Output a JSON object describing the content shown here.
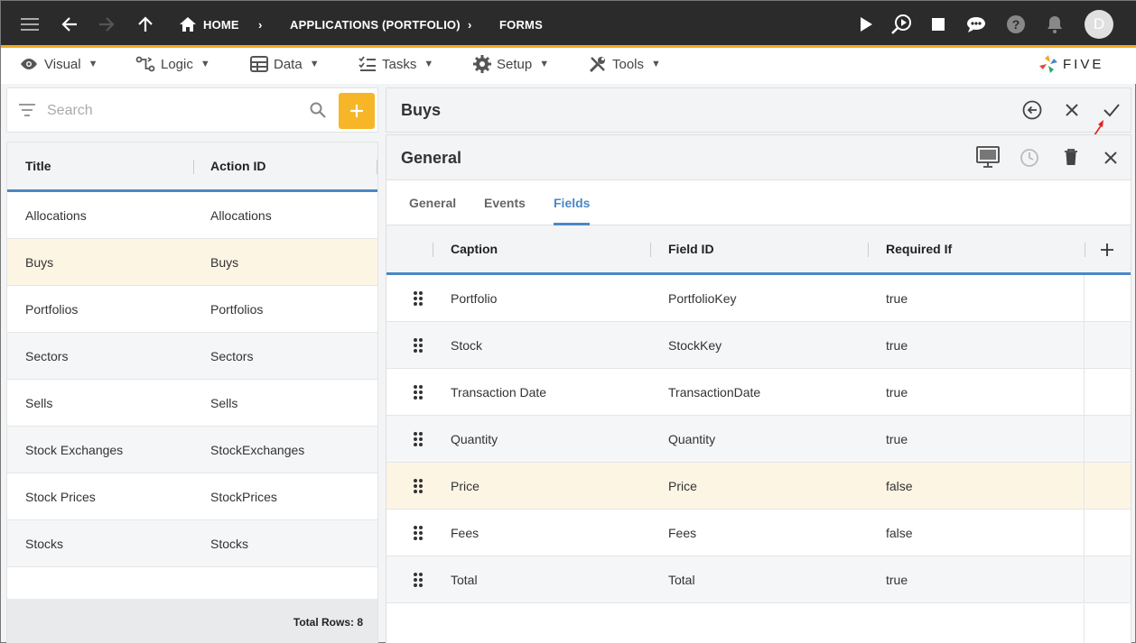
{
  "topbar": {
    "breadcrumb": [
      "HOME",
      "APPLICATIONS (PORTFOLIO)",
      "FORMS"
    ],
    "avatar_letter": "D",
    "icons": [
      "menu-icon",
      "back-arrow-icon",
      "forward-arrow-icon",
      "up-arrow-icon",
      "home-icon",
      "play-icon",
      "search-play-icon",
      "stop-icon",
      "chat-icon",
      "help-icon",
      "bell-icon"
    ]
  },
  "menubar": {
    "items": [
      "Visual",
      "Logic",
      "Data",
      "Tasks",
      "Setup",
      "Tools"
    ],
    "logo_text": "FIVE"
  },
  "search": {
    "placeholder": "Search"
  },
  "list": {
    "columns": [
      "Title",
      "Action ID"
    ],
    "rows": [
      {
        "title": "Allocations",
        "action_id": "Allocations"
      },
      {
        "title": "Buys",
        "action_id": "Buys"
      },
      {
        "title": "Portfolios",
        "action_id": "Portfolios"
      },
      {
        "title": "Sectors",
        "action_id": "Sectors"
      },
      {
        "title": "Sells",
        "action_id": "Sells"
      },
      {
        "title": "Stock Exchanges",
        "action_id": "StockExchanges"
      },
      {
        "title": "Stock Prices",
        "action_id": "StockPrices"
      },
      {
        "title": "Stocks",
        "action_id": "Stocks"
      }
    ],
    "selected_index": 1,
    "footer": "Total Rows: 8"
  },
  "form": {
    "title": "Buys",
    "sub_title": "General",
    "tabs": [
      "General",
      "Events",
      "Fields"
    ],
    "active_tab": "Fields",
    "grid_columns": [
      "Caption",
      "Field ID",
      "Required If"
    ],
    "grid_rows": [
      {
        "caption": "Portfolio",
        "field_id": "PortfolioKey",
        "required_if": "true"
      },
      {
        "caption": "Stock",
        "field_id": "StockKey",
        "required_if": "true"
      },
      {
        "caption": "Transaction Date",
        "field_id": "TransactionDate",
        "required_if": "true"
      },
      {
        "caption": "Quantity",
        "field_id": "Quantity",
        "required_if": "true"
      },
      {
        "caption": "Price",
        "field_id": "Price",
        "required_if": "false"
      },
      {
        "caption": "Fees",
        "field_id": "Fees",
        "required_if": "false"
      },
      {
        "caption": "Total",
        "field_id": "Total",
        "required_if": "true"
      }
    ],
    "selected_row_index": 4
  },
  "colors": {
    "accent_blue": "#4a88c7",
    "accent_orange": "#f6b627",
    "topbar": "#2b2b2b",
    "selected_row": "#fdf5e4"
  }
}
